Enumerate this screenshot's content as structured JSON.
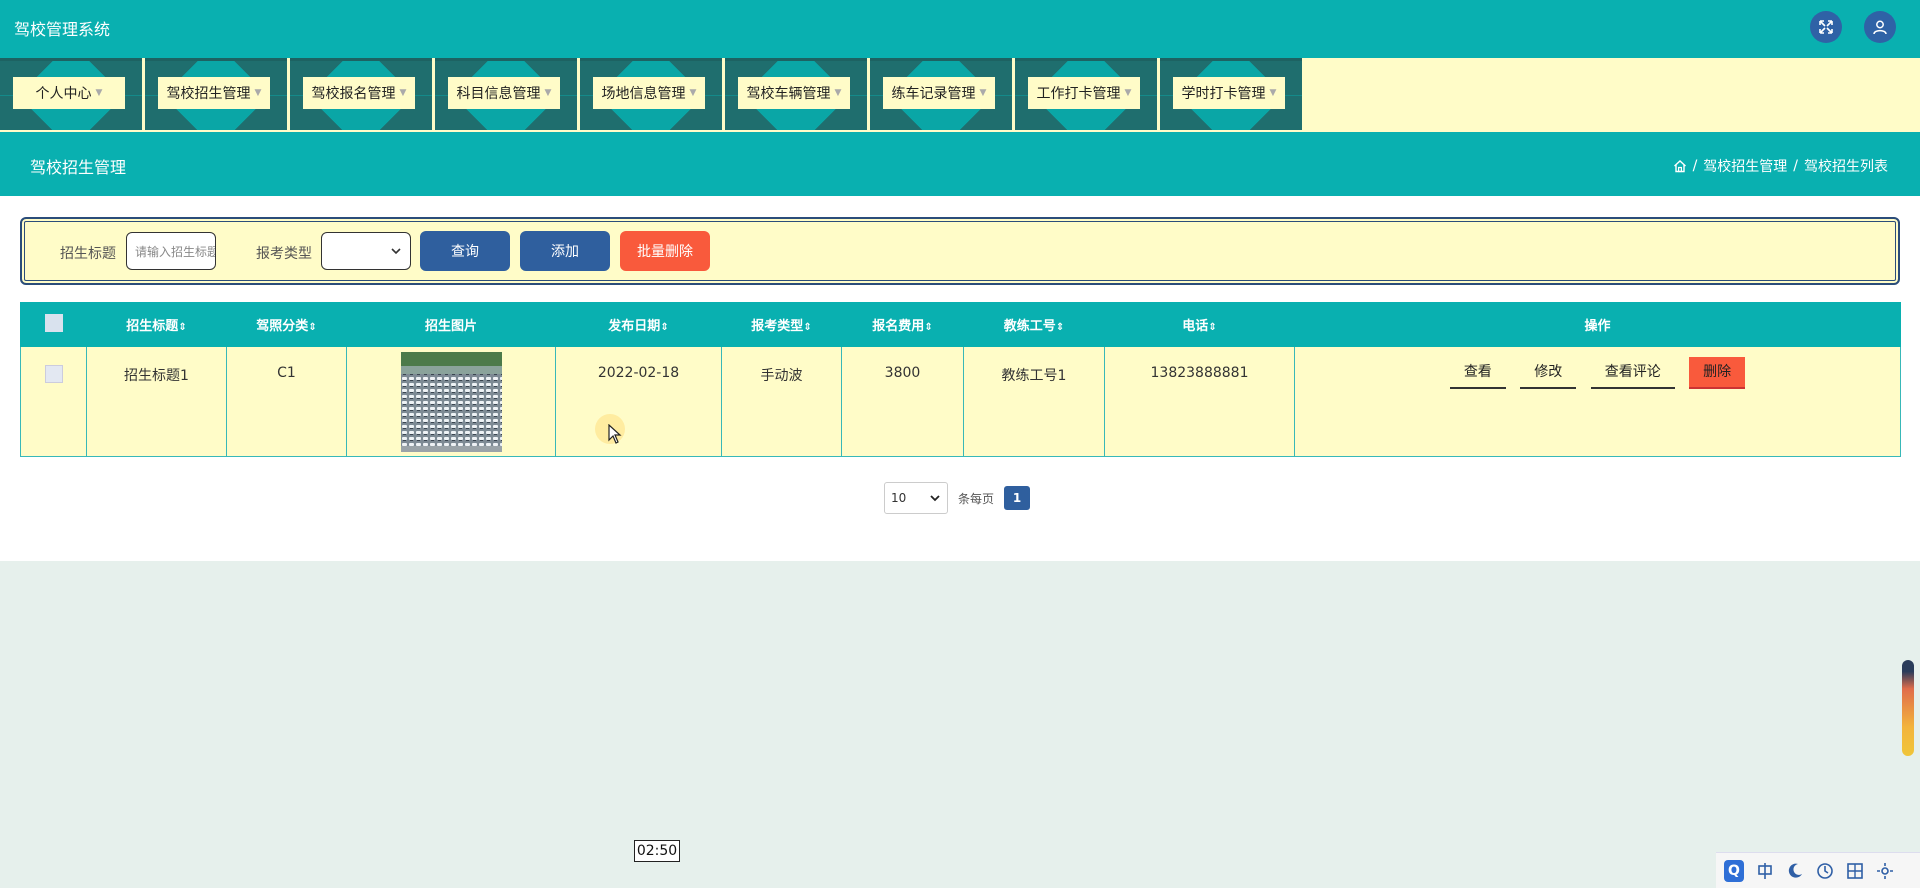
{
  "app": {
    "title": "驾校管理系统"
  },
  "menu": [
    {
      "label": "个人中心"
    },
    {
      "label": "驾校招生管理"
    },
    {
      "label": "驾校报名管理"
    },
    {
      "label": "科目信息管理"
    },
    {
      "label": "场地信息管理"
    },
    {
      "label": "驾校车辆管理"
    },
    {
      "label": "练车记录管理"
    },
    {
      "label": "工作打卡管理"
    },
    {
      "label": "学时打卡管理"
    }
  ],
  "page": {
    "title": "驾校招生管理",
    "breadcrumb": [
      "驾校招生管理",
      "驾校招生列表"
    ],
    "separator": "/"
  },
  "search": {
    "title_label": "招生标题",
    "title_placeholder": "请输入招生标题",
    "type_label": "报考类型",
    "type_value": "",
    "query_label": "查询",
    "add_label": "添加",
    "batch_delete_label": "批量删除"
  },
  "table": {
    "headers": [
      "招生标题",
      "驾照分类",
      "招生图片",
      "发布日期",
      "报考类型",
      "报名费用",
      "教练工号",
      "电话",
      "操作"
    ],
    "sort_glyph": "⇕",
    "rows": [
      {
        "title": "招生标题1",
        "license": "C1",
        "date": "2022-02-18",
        "type": "手动波",
        "fee": "3800",
        "coach": "教练工号1",
        "phone": "13823888881"
      }
    ],
    "actions": {
      "view": "查看",
      "edit": "修改",
      "comments": "查看评论",
      "delete": "删除"
    }
  },
  "pager": {
    "page_size": "10",
    "per_page_label": "条每页",
    "current_page": "1"
  },
  "overlay": {
    "time": "02:50"
  },
  "colors": {
    "primary": "#09b0b0",
    "accent": "#2f5f9e",
    "danger": "#f95a3c",
    "panel": "#fffcc8"
  }
}
